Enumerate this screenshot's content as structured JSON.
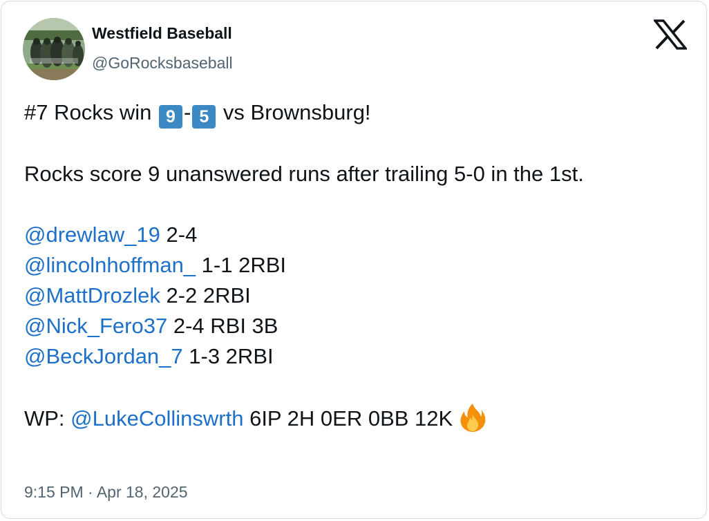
{
  "account": {
    "name": "Westfield Baseball",
    "handle": "@GoRocksbaseball",
    "avatar_icon": "team-photo-avatar"
  },
  "brand": {
    "logo_icon": "x-logo-icon",
    "mention_color": "#1d70c9",
    "keycap_color": "#3b88c3"
  },
  "tweet": {
    "headline": {
      "prefix": "#7 Rocks win ",
      "score_home": "9",
      "dash": "-",
      "score_away": "5",
      "suffix": " vs Brownsburg!"
    },
    "summary": "Rocks score 9 unanswered runs after trailing 5-0 in the 1st.",
    "stat_lines": [
      {
        "mention": "@drewlaw_19",
        "stats": " 2-4"
      },
      {
        "mention": "@lincolnhoffman_",
        "stats": " 1-1 2RBI"
      },
      {
        "mention": "@MattDrozlek",
        "stats": " 2-2 2RBI"
      },
      {
        "mention": "@Nick_Fero37",
        "stats": " 2-4 RBI 3B"
      },
      {
        "mention": "@BeckJordan_7",
        "stats": " 1-3 2RBI"
      }
    ],
    "pitcher": {
      "label": "WP: ",
      "mention": "@LukeCollinswrth",
      "stats": " 6IP 2H 0ER 0BB 12K ",
      "emoji_icon": "fire-emoji-icon"
    }
  },
  "timestamp": "9:15 PM · Apr 18, 2025"
}
